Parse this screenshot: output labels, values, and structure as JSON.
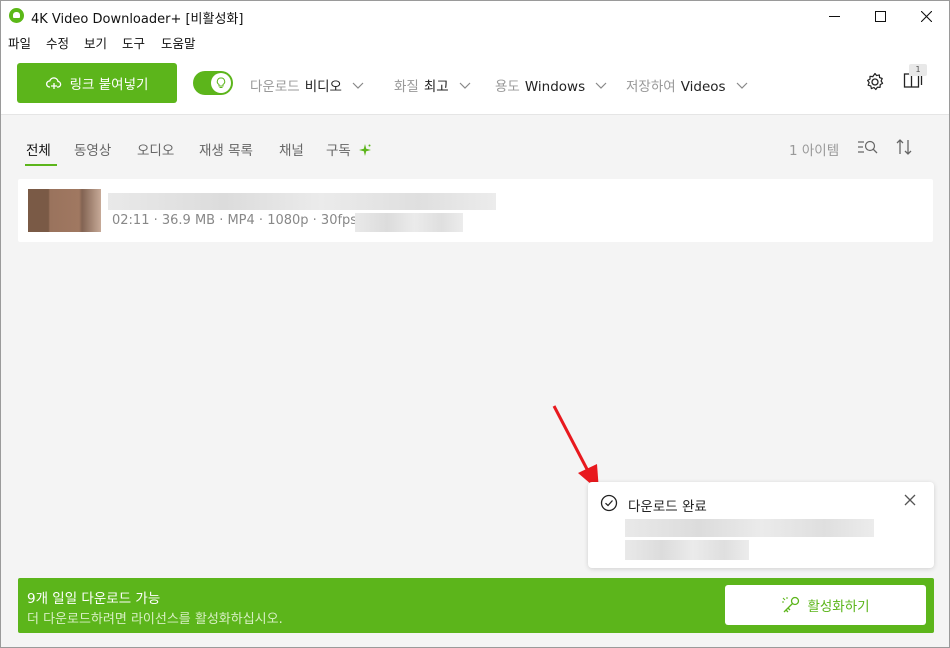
{
  "window": {
    "title": "4K Video Downloader+ [비활성화]",
    "controls": {
      "minimize": "—",
      "maximize": "☐",
      "close": "✕"
    }
  },
  "menu": [
    "파일",
    "수정",
    "보기",
    "도구",
    "도움말"
  ],
  "toolbar": {
    "paste_label": "링크 붙여넣기",
    "smart_mode_on": true,
    "options": [
      {
        "label": "다운로드",
        "value": "비디오"
      },
      {
        "label": "화질",
        "value": "최고"
      },
      {
        "label": "용도",
        "value": "Windows"
      },
      {
        "label": "저장하여",
        "value": "Videos"
      }
    ],
    "queue_count": "1"
  },
  "tabs": [
    "전체",
    "동영상",
    "오디오",
    "재생 목록",
    "채널",
    "구독"
  ],
  "active_tab": "전체",
  "item_count": "1 아이템",
  "downloads": [
    {
      "meta": "02:11 · 36.9 MB · MP4 · 1080p · 30fps ·"
    }
  ],
  "toast": {
    "title": "다운로드 완료",
    "close": "✕"
  },
  "banner": {
    "title": "9개 일일 다운로드 가능",
    "subtitle": "더 다운로드하려면 라이선스를 활성화하십시오.",
    "button_label": "활성화하기"
  },
  "colors": {
    "accent": "#5cb51b",
    "annotation_arrow": "#e8191e"
  }
}
